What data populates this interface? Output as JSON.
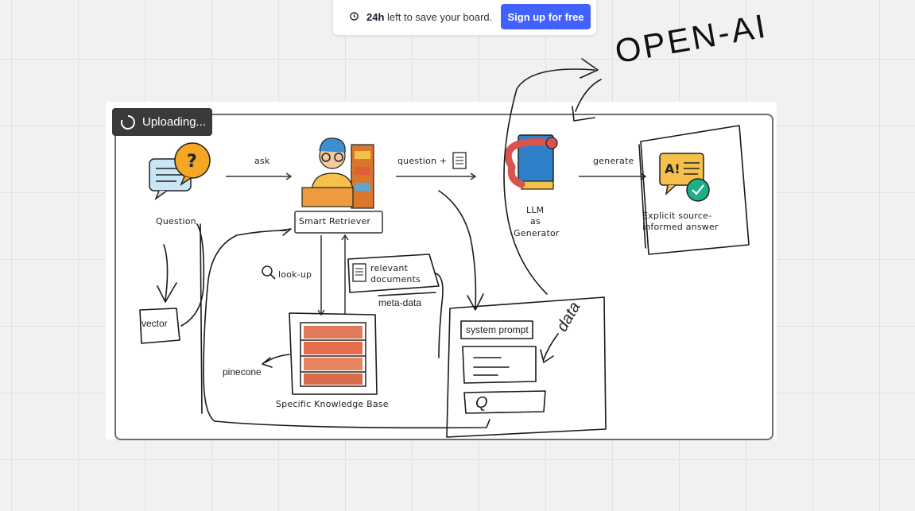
{
  "topbar": {
    "time_bold": "24h",
    "time_rest": " left to save your board.",
    "signup_label": "Sign up for free"
  },
  "upload": {
    "label": "Uploading..."
  },
  "diagram": {
    "ask": "ask",
    "question": "Question",
    "smart_retriever": "Smart Retriever",
    "question_plus": "question +",
    "llm_line1": "LLM",
    "llm_line2": "as",
    "llm_line3": "Generator",
    "generate": "generate",
    "answer_line1": "Explicit source-",
    "answer_line2": "informed answer",
    "look_up": "look-up",
    "relevant_line1": "relevant",
    "relevant_line2": "documents",
    "knowledge_base": "Specific Knowledge Base"
  },
  "annotations": {
    "vector": "vector",
    "meta_data": "meta-data",
    "pinecone": "pinecone",
    "system_prompt": "system prompt",
    "data": "data",
    "q": "Q",
    "open_ai": "OPEN-AI"
  },
  "colors": {
    "accent": "#4262ff",
    "toast": "#3a3a3a"
  }
}
